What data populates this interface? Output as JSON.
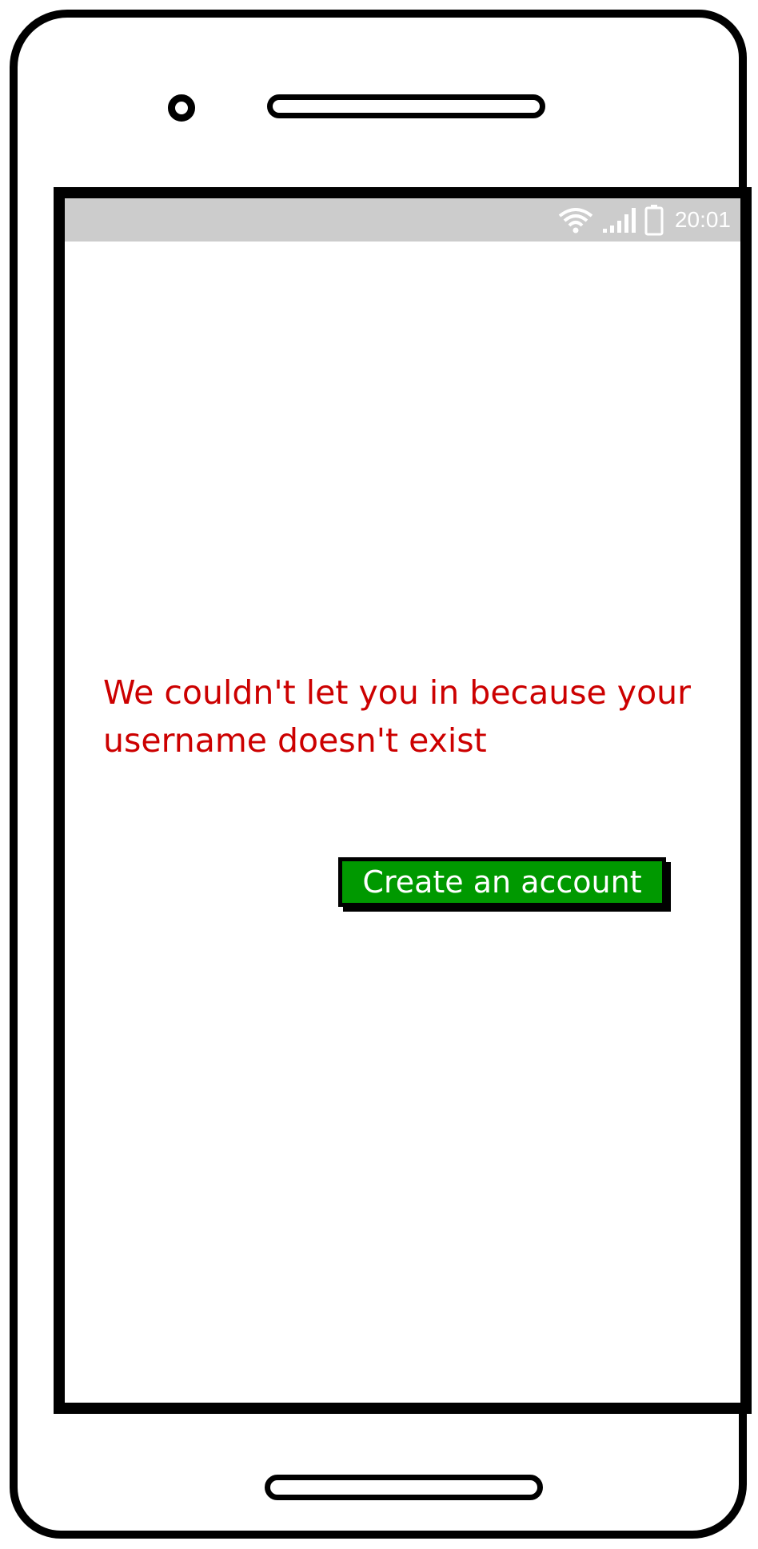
{
  "status_bar": {
    "time": "20:01",
    "icons": [
      "wifi-icon",
      "signal-icon",
      "battery-icon"
    ]
  },
  "content": {
    "error_message": "We couldn't let you in because your username doesn't exist",
    "error_color": "#cc0000"
  },
  "actions": {
    "create_account_label": "Create an account",
    "button_color": "#009900"
  }
}
